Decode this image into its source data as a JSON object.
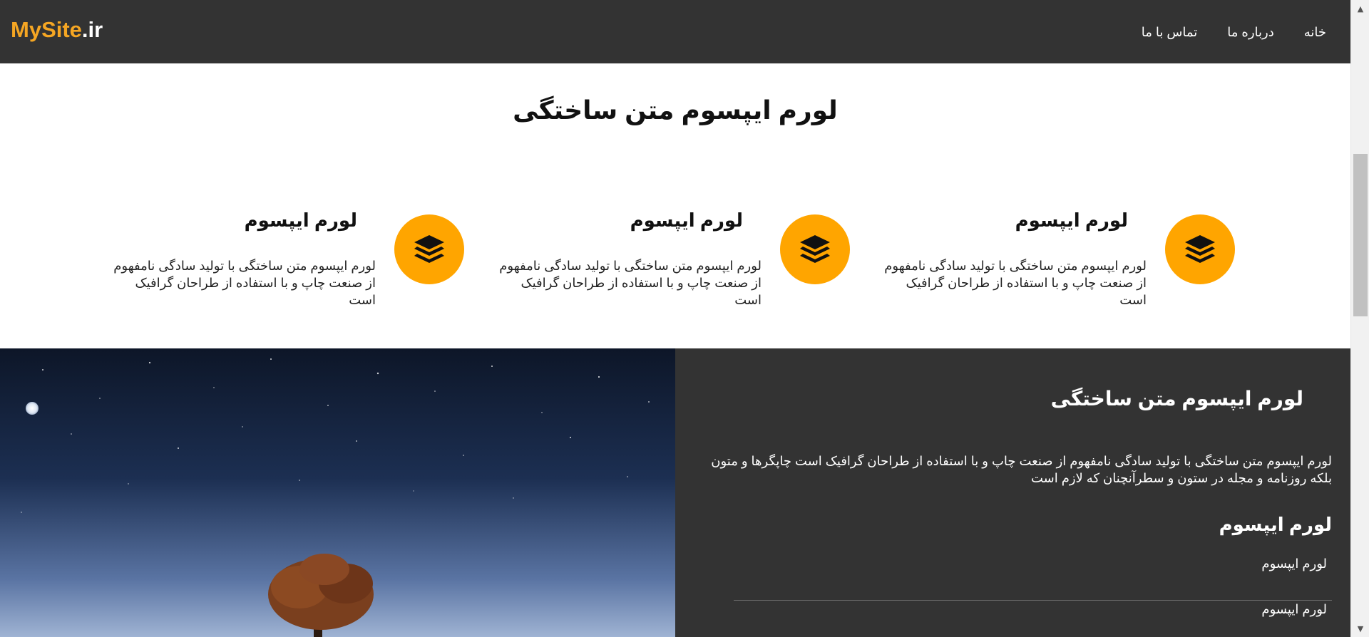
{
  "header": {
    "logo_brand": "MySite",
    "logo_tld": ".ir",
    "nav": [
      "خانه",
      "درباره ما",
      "تماس با ما"
    ]
  },
  "features": {
    "title": "لورم ایپسوم متن ساختگی",
    "items": [
      {
        "title": "لورم ایپسوم",
        "text": "لورم ایپسوم متن ساختگی با تولید سادگی نامفهوم از صنعت چاپ و با استفاده از طراحان گرافیک است",
        "icon": "layers-icon"
      },
      {
        "title": "لورم ایپسوم",
        "text": "لورم ایپسوم متن ساختگی با تولید سادگی نامفهوم از صنعت چاپ و با استفاده از طراحان گرافیک است",
        "icon": "layers-icon"
      },
      {
        "title": "لورم ایپسوم",
        "text": "لورم ایپسوم متن ساختگی با تولید سادگی نامفهوم از صنعت چاپ و با استفاده از طراحان گرافیک است",
        "icon": "layers-icon"
      }
    ]
  },
  "panel": {
    "title": "لورم ایپسوم متن ساختگی",
    "text": "لورم ایپسوم متن ساختگی با تولید سادگی نامفهوم از صنعت چاپ و با استفاده از طراحان گرافیک است چاپگرها و متون بلکه روزنامه و مجله در ستون و سطرآنچنان که لازم است",
    "subtitle": "لورم ایپسوم",
    "list": [
      "لورم ایپسوم",
      "لورم ایپسوم"
    ]
  },
  "colors": {
    "header_bg": "#333333",
    "accent": "#ffa500",
    "logo_brand": "#f5a623"
  }
}
